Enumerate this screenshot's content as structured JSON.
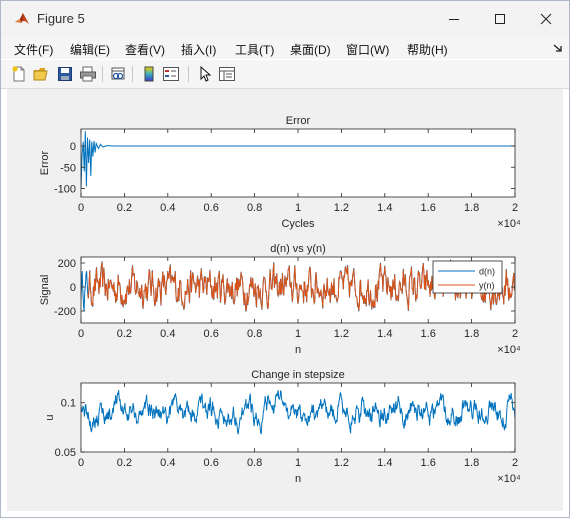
{
  "window": {
    "title": "Figure 5"
  },
  "menu": [
    "文件(F)",
    "编辑(E)",
    "查看(V)",
    "插入(I)",
    "工具(T)",
    "桌面(D)",
    "窗口(W)",
    "帮助(H)"
  ],
  "toolbar_icons": [
    "new-figure-icon",
    "open-file-icon",
    "save-icon",
    "print-icon",
    "link-plot-icon",
    "insert-colorbar-icon",
    "insert-legend-icon",
    "pointer-icon",
    "property-inspector-icon"
  ],
  "colors": {
    "series1": "#0072bd",
    "series2": "#d95319"
  },
  "chart_data": [
    {
      "type": "line",
      "title": "Error",
      "xlabel": "Cycles",
      "ylabel": "Error",
      "xlim": [
        0,
        20000
      ],
      "ylim": [
        -120,
        40
      ],
      "x_tick_labels": [
        "0",
        "0.2",
        "0.4",
        "0.6",
        "0.8",
        "1",
        "1.2",
        "1.4",
        "1.6",
        "1.8",
        "2"
      ],
      "x_exponent": "×10⁴",
      "y_tick_values": [
        0,
        -50,
        -100
      ],
      "y_tick_labels": [
        "0",
        "-50",
        "-100"
      ],
      "series": [
        {
          "x": [
            0,
            50,
            100,
            150,
            200,
            250,
            300,
            350,
            400,
            450,
            500,
            550,
            600,
            650,
            700,
            800,
            900,
            1000,
            1200,
            1500,
            2000,
            20000
          ],
          "y": [
            -100,
            -20,
            10,
            -60,
            35,
            -95,
            20,
            -40,
            15,
            -70,
            10,
            -25,
            12,
            -15,
            6,
            -6,
            4,
            -2,
            1,
            0,
            0,
            0
          ]
        }
      ]
    },
    {
      "type": "line",
      "title": "d(n) vs y(n)",
      "xlabel": "n",
      "ylabel": "Signal",
      "xlim": [
        0,
        20000
      ],
      "ylim": [
        -300,
        250
      ],
      "x_tick_labels": [
        "0",
        "0.2",
        "0.4",
        "0.6",
        "0.8",
        "1",
        "1.2",
        "1.4",
        "1.6",
        "1.8",
        "2"
      ],
      "x_exponent": "×10⁴",
      "y_tick_values": [
        200,
        0,
        -200
      ],
      "y_tick_labels": [
        "200",
        "0",
        "-200"
      ],
      "legend": {
        "position": "top-right",
        "entries": [
          "d(n)",
          "y(n)"
        ]
      },
      "series_note": "noise signal, roughly ±250 amplitude; y(n) overlays d(n) after convergence near n≈500"
    },
    {
      "type": "line",
      "title": "Change in stepsize",
      "xlabel": "n",
      "ylabel": "u",
      "xlim": [
        0,
        20000
      ],
      "ylim": [
        0.05,
        0.12
      ],
      "x_tick_labels": [
        "0",
        "0.2",
        "0.4",
        "0.6",
        "0.8",
        "1",
        "1.2",
        "1.4",
        "1.6",
        "1.8",
        "2"
      ],
      "x_exponent": "×10⁴",
      "y_tick_values": [
        0.1,
        0.05
      ],
      "y_tick_labels": [
        "0.1",
        "0.05"
      ],
      "series_note": "fluctuates between about 0.068 and 0.118"
    }
  ]
}
